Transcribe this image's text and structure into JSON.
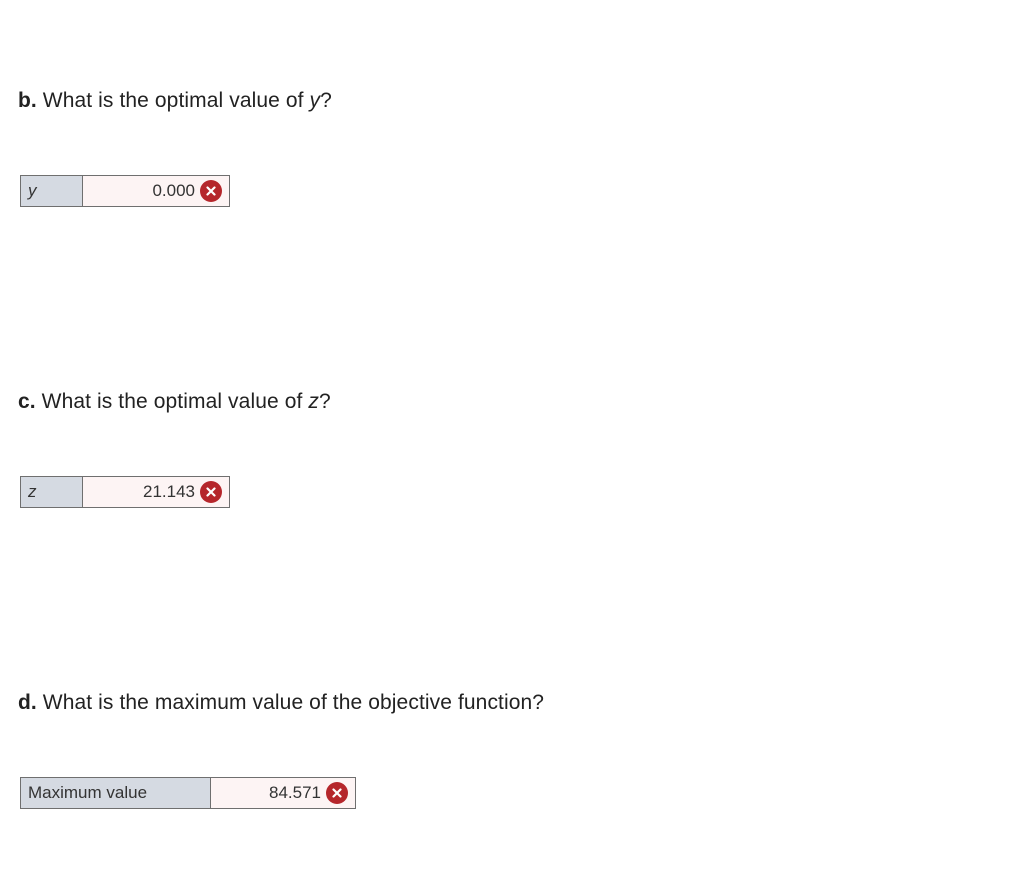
{
  "questions": [
    {
      "part": "b.",
      "text_before": " What is the optimal value of ",
      "variable": "y",
      "text_after": "?",
      "answer_label": "y",
      "answer_value": "0.000",
      "status_icon": "incorrect-x-icon"
    },
    {
      "part": "c.",
      "text_before": " What is the optimal value of ",
      "variable": "z",
      "text_after": "?",
      "answer_label": "z",
      "answer_value": "21.143",
      "status_icon": "incorrect-x-icon"
    },
    {
      "part": "d.",
      "text_before": " What is the maximum value of the objective function?",
      "answer_label": "Maximum value",
      "answer_value": "84.571",
      "status_icon": "incorrect-x-icon"
    }
  ],
  "colors": {
    "label_background": "#d5dae2",
    "value_background": "#fdf4f4",
    "incorrect_icon": "#b5262b",
    "border": "#6f6f6f"
  }
}
